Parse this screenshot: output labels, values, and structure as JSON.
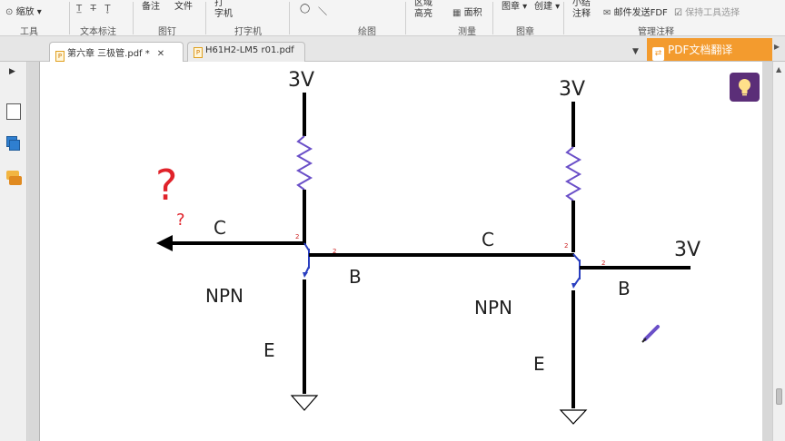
{
  "ribbon": {
    "zoom_label": "缩放",
    "tools_group": "工具",
    "textmark_group": "文本标注",
    "pin_items": [
      "备注",
      "文件"
    ],
    "pin_group": "图钉",
    "typewriter_label": "打\n字机",
    "typewriter_group": "打字机",
    "drawing_group": "绘图",
    "area_highlight_label": "区域\n高亮",
    "area_label": "面积",
    "measure_group": "测量",
    "stamp_label": "图章",
    "create_label": "创建",
    "stamp_group": "图章",
    "summary_label": "小结\n注释",
    "email_fdf_label": "邮件发送FDF",
    "keep_tool_label": "保持工具选择",
    "manage_group": "管理注释"
  },
  "tabs": [
    {
      "label": "第六章 三极管.pdf *",
      "active": true
    },
    {
      "label": "H61H2-LM5 r01.pdf",
      "active": false
    }
  ],
  "translate_button": "PDF文档翻译",
  "circuit_labels": {
    "left_vcc": "3V",
    "right_vcc": "3V",
    "right_base_supply": "3V",
    "question_big": "?",
    "question_small": "?",
    "left_c": "C",
    "left_b": "B",
    "left_npn": "NPN",
    "left_e": "E",
    "mid_c": "C",
    "right_b": "B",
    "right_npn": "NPN",
    "right_e": "E",
    "pin_small": "2"
  },
  "colors": {
    "accent_orange": "#f39b2e",
    "resistor_blue": "#6a4fc8",
    "question_red": "#e0222a",
    "bulb_purple": "#5b2e78"
  },
  "icons": [
    "zoom-icon",
    "pages-icon",
    "layers-icon",
    "comments-icon",
    "lightbulb-icon",
    "pdf-icon",
    "close-icon"
  ]
}
